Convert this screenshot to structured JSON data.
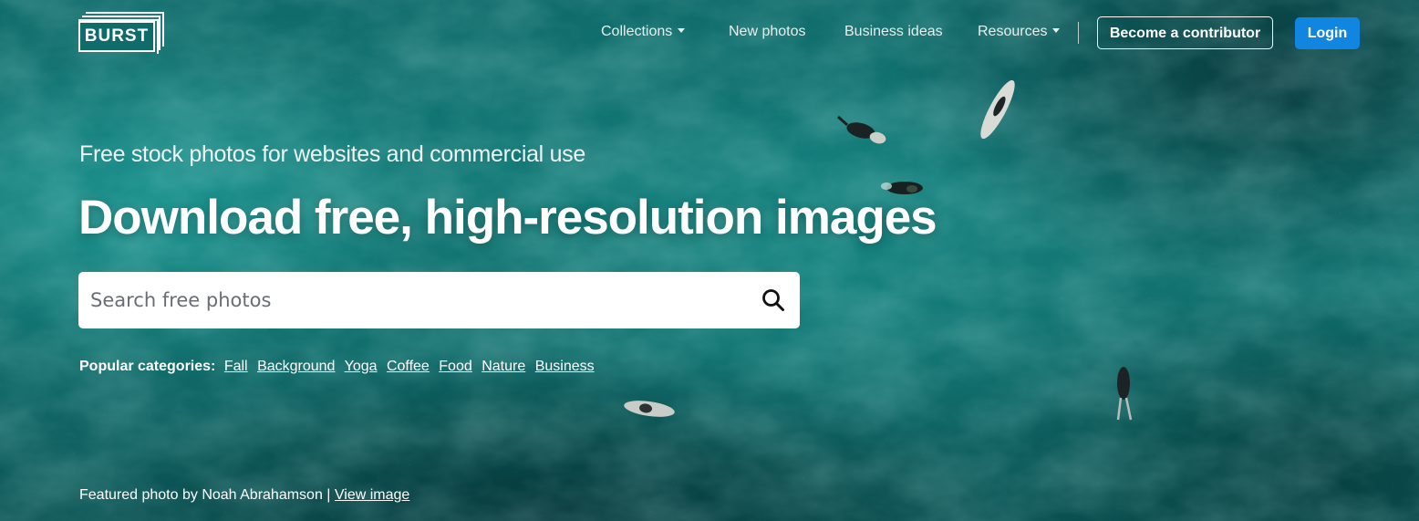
{
  "brand": {
    "logo_text": "BURST"
  },
  "nav": {
    "collections": "Collections",
    "new_photos": "New photos",
    "business_ideas": "Business ideas",
    "resources": "Resources",
    "become_contributor": "Become a contributor",
    "login": "Login"
  },
  "hero": {
    "subtitle": "Free stock photos for websites and commercial use",
    "headline": "Download free, high-resolution images"
  },
  "search": {
    "placeholder": "Search free photos",
    "value": ""
  },
  "popular": {
    "label": "Popular categories:",
    "categories": [
      "Fall",
      "Background",
      "Yoga",
      "Coffee",
      "Food",
      "Nature",
      "Business"
    ]
  },
  "credit": {
    "text": "Featured photo by Noah Abrahamson |",
    "link": "View image"
  },
  "colors": {
    "login_bg": "#1086e0",
    "sea": "#137a77"
  }
}
